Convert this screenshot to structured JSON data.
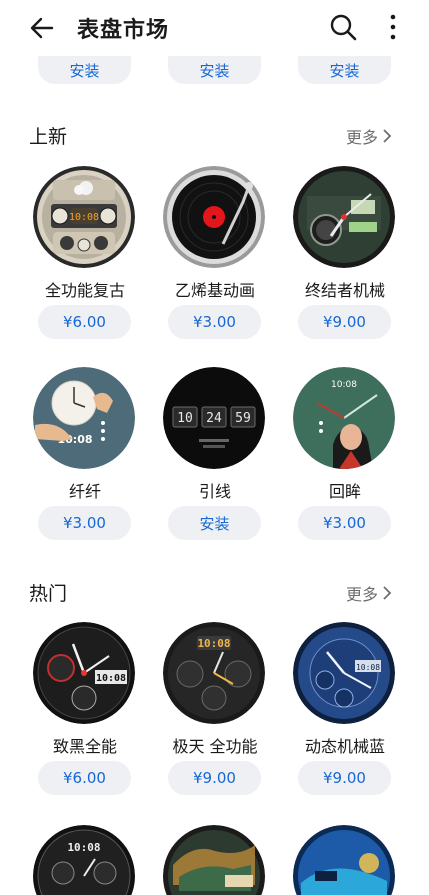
{
  "header": {
    "title": "表盘市场",
    "back_icon": "back-arrow-icon",
    "search_icon": "search-icon",
    "menu_icon": "more-vertical-icon"
  },
  "top_row": {
    "buttons": [
      "安装",
      "安装",
      "安装"
    ]
  },
  "section_new": {
    "title": "上新",
    "more": "更多",
    "items": [
      {
        "name": "全功能复古",
        "price": "¥6.00"
      },
      {
        "name": "乙烯基动画",
        "price": "¥3.00"
      },
      {
        "name": "终结者机械",
        "price": "¥9.00"
      },
      {
        "name": "纤纤",
        "price": "¥3.00"
      },
      {
        "name": "引线",
        "price": "安装"
      },
      {
        "name": "回眸",
        "price": "¥3.00"
      }
    ]
  },
  "section_hot": {
    "title": "热门",
    "more": "更多",
    "items": [
      {
        "name": "致黑全能",
        "price": "¥6.00"
      },
      {
        "name": "极天 全功能",
        "price": "¥9.00"
      },
      {
        "name": "动态机械蓝",
        "price": "¥9.00"
      }
    ]
  },
  "face_text": {
    "retro_time": "10:08",
    "fiber_time": "10:08",
    "fuse_digits": [
      "10",
      "24",
      "59"
    ],
    "glance_time": "10:08",
    "black_time": "10:08",
    "polar_time": "10:08",
    "blue_time": "10:08",
    "row4_time": "10:08"
  },
  "colors": {
    "accent": "#1767d6",
    "pill_bg": "#eef0f3",
    "muted": "#6e6e6e"
  }
}
